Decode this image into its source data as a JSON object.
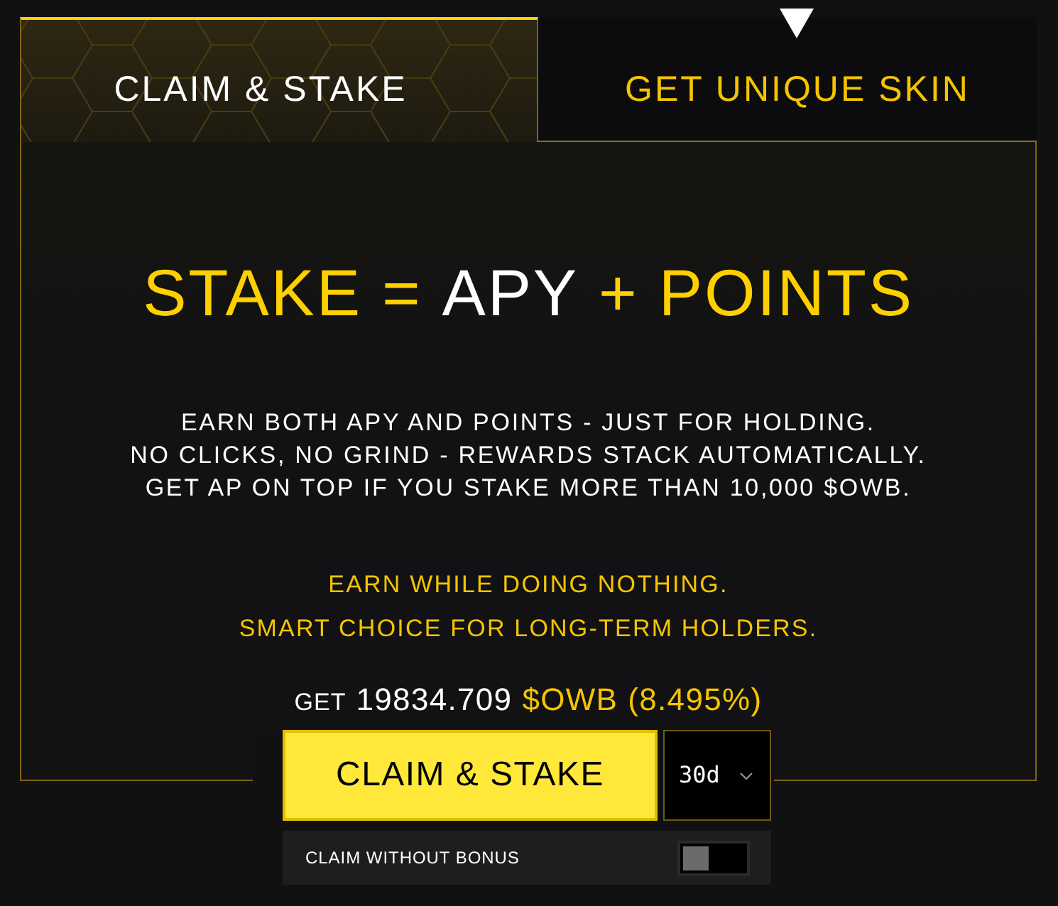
{
  "tabs": [
    {
      "label": "CLAIM & STAKE",
      "selected": true
    },
    {
      "label": "GET UNIQUE SKIN",
      "selected": false
    }
  ],
  "headline": [
    {
      "text": "STAKE =",
      "color": "#ffd000"
    },
    {
      "text": "APY",
      "color": "#ffffff"
    },
    {
      "text": "+ POINTS",
      "color": "#ffd000"
    }
  ],
  "description": [
    "EARN BOTH APY AND POINTS - JUST FOR HOLDING.",
    "NO CLICKS, NO GRIND - REWARDS STACK AUTOMATICALLY.",
    "GET AP ON TOP IF YOU STAKE MORE THAN 10,000 $OWB."
  ],
  "taglines": [
    "EARN WHILE DOING NOTHING.",
    "SMART CHOICE FOR LONG-TERM HOLDERS."
  ],
  "reward": {
    "label": "GET",
    "amount": "19834.709",
    "token": "$OWB",
    "rate": "(8.495%)"
  },
  "claim_button": {
    "label": "CLAIM & STAKE"
  },
  "duration_select": {
    "value": "30d"
  },
  "bonus_toggle": {
    "label": "CLAIM WITHOUT BONUS",
    "on": false
  }
}
